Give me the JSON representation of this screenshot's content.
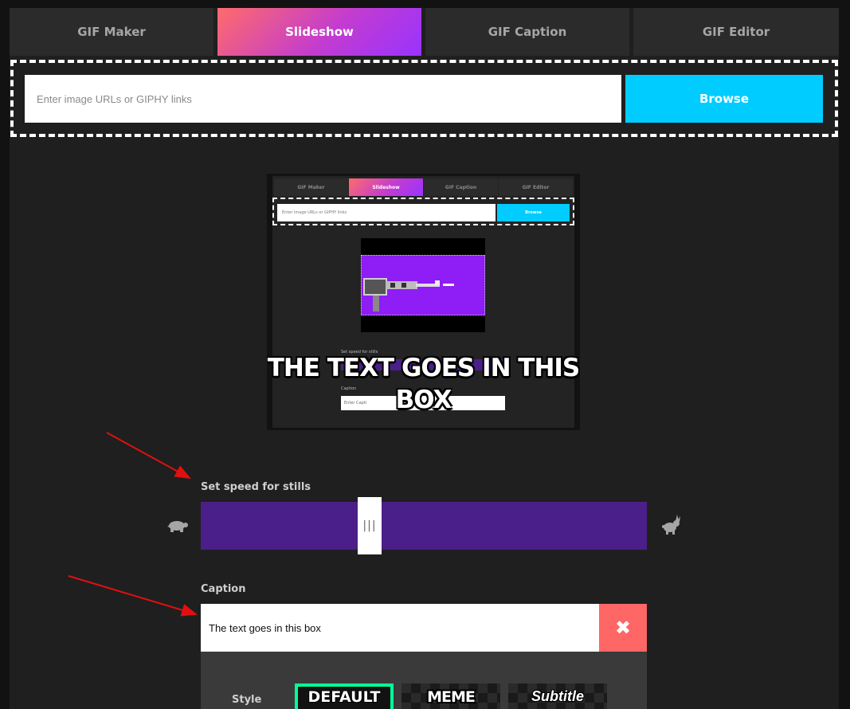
{
  "tabs": [
    {
      "label": "GIF Maker",
      "active": false
    },
    {
      "label": "Slideshow",
      "active": true
    },
    {
      "label": "GIF Caption",
      "active": false
    },
    {
      "label": "GIF Editor",
      "active": false
    }
  ],
  "upload": {
    "placeholder": "Enter image URLs or GIPHY links",
    "browse_label": "Browse"
  },
  "preview": {
    "tabs": [
      "GIF Maker",
      "Slideshow",
      "GIF Caption",
      "GIF Editor"
    ],
    "input_placeholder": "Enter image URLs or GIPHY links",
    "browse_label": "Browse",
    "speed_label": "Set speed for stills",
    "caption_label": "Caption",
    "caption_placeholder": "Enter Capti",
    "caption_overlay": "THE TEXT GOES IN THIS BOX"
  },
  "speed": {
    "label": "Set speed for stills",
    "handle_grip": "|||",
    "value_fraction": 0.38,
    "slow_icon": "turtle-icon",
    "fast_icon": "rabbit-icon"
  },
  "caption": {
    "label": "Caption",
    "value": "The text goes in this box",
    "clear_icon": "close-icon",
    "clear_glyph": "✖"
  },
  "style": {
    "label": "Style",
    "options": [
      {
        "label": "DEFAULT",
        "selected": true
      },
      {
        "label": "MEME",
        "selected": false
      },
      {
        "label": "Subtitle",
        "selected": false
      }
    ]
  },
  "colors": {
    "accent_cyan": "#00ccff",
    "slider_purple": "#4b1f8a",
    "clear_red": "#ff6666",
    "selected_green": "#00ff99",
    "annotation_arrow": "#e01010"
  }
}
